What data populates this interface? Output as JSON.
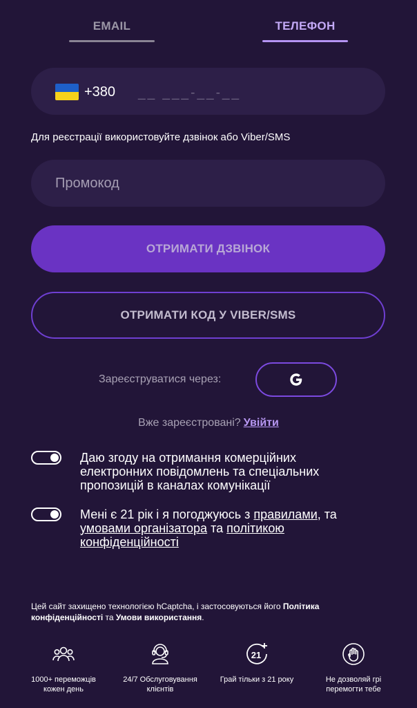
{
  "tabs": {
    "email": "EMAIL",
    "phone": "ТЕЛЕФОН"
  },
  "phone": {
    "country_icon": "ukraine-flag-icon",
    "prefix": "+380",
    "mask": "__ ___-__-__"
  },
  "hint": "Для реєстрації використовуйте дзвінок або Viber/SMS",
  "promo": {
    "placeholder": "Промокод"
  },
  "buttons": {
    "call": "ОТРИМАТИ ДЗВІНОК",
    "viber": "ОТРИМАТИ КОД У VIBER/SMS"
  },
  "social": {
    "label": "Зареєструватися через:",
    "google_icon": "google-icon"
  },
  "login": {
    "question": "Вже зареєстровані?",
    "link": "Увійти"
  },
  "consent1": {
    "line1": "Даю згоду на отримання комерційних",
    "line2": "електронних повідомлень та спеціальних",
    "line3": "пропозицій в каналах комунікації"
  },
  "consent2": {
    "part1": "Мені є 21 рік і я погоджуюсь з ",
    "rules": "правилами",
    "part2": ", та",
    "organizer": "умовами організатора",
    "part3": " та ",
    "policy": "політикою",
    "privacy": "конфіденційності"
  },
  "captcha": {
    "text": "Цей сайт захищено технологією hCaptcha, і застосовуються його ",
    "policy": "Політика конфіденційності",
    "and": " та ",
    "terms": "Умови використання",
    "end": "."
  },
  "features": [
    {
      "icon": "users-icon",
      "label1": "1000+ переможців",
      "label2": "кожен день"
    },
    {
      "icon": "support-headset-icon",
      "label1": "24/7 Обслуговування",
      "label2": "клієнтів"
    },
    {
      "icon": "age-21-plus-icon",
      "label1": "Грай тільки з 21 року",
      "label2": ""
    },
    {
      "icon": "stop-hand-icon",
      "label1": "Не дозволяй грі",
      "label2": "перемогти тебе"
    }
  ],
  "colors": {
    "background": "#221538",
    "accent": "#6a33c3",
    "link": "#b898f3"
  }
}
